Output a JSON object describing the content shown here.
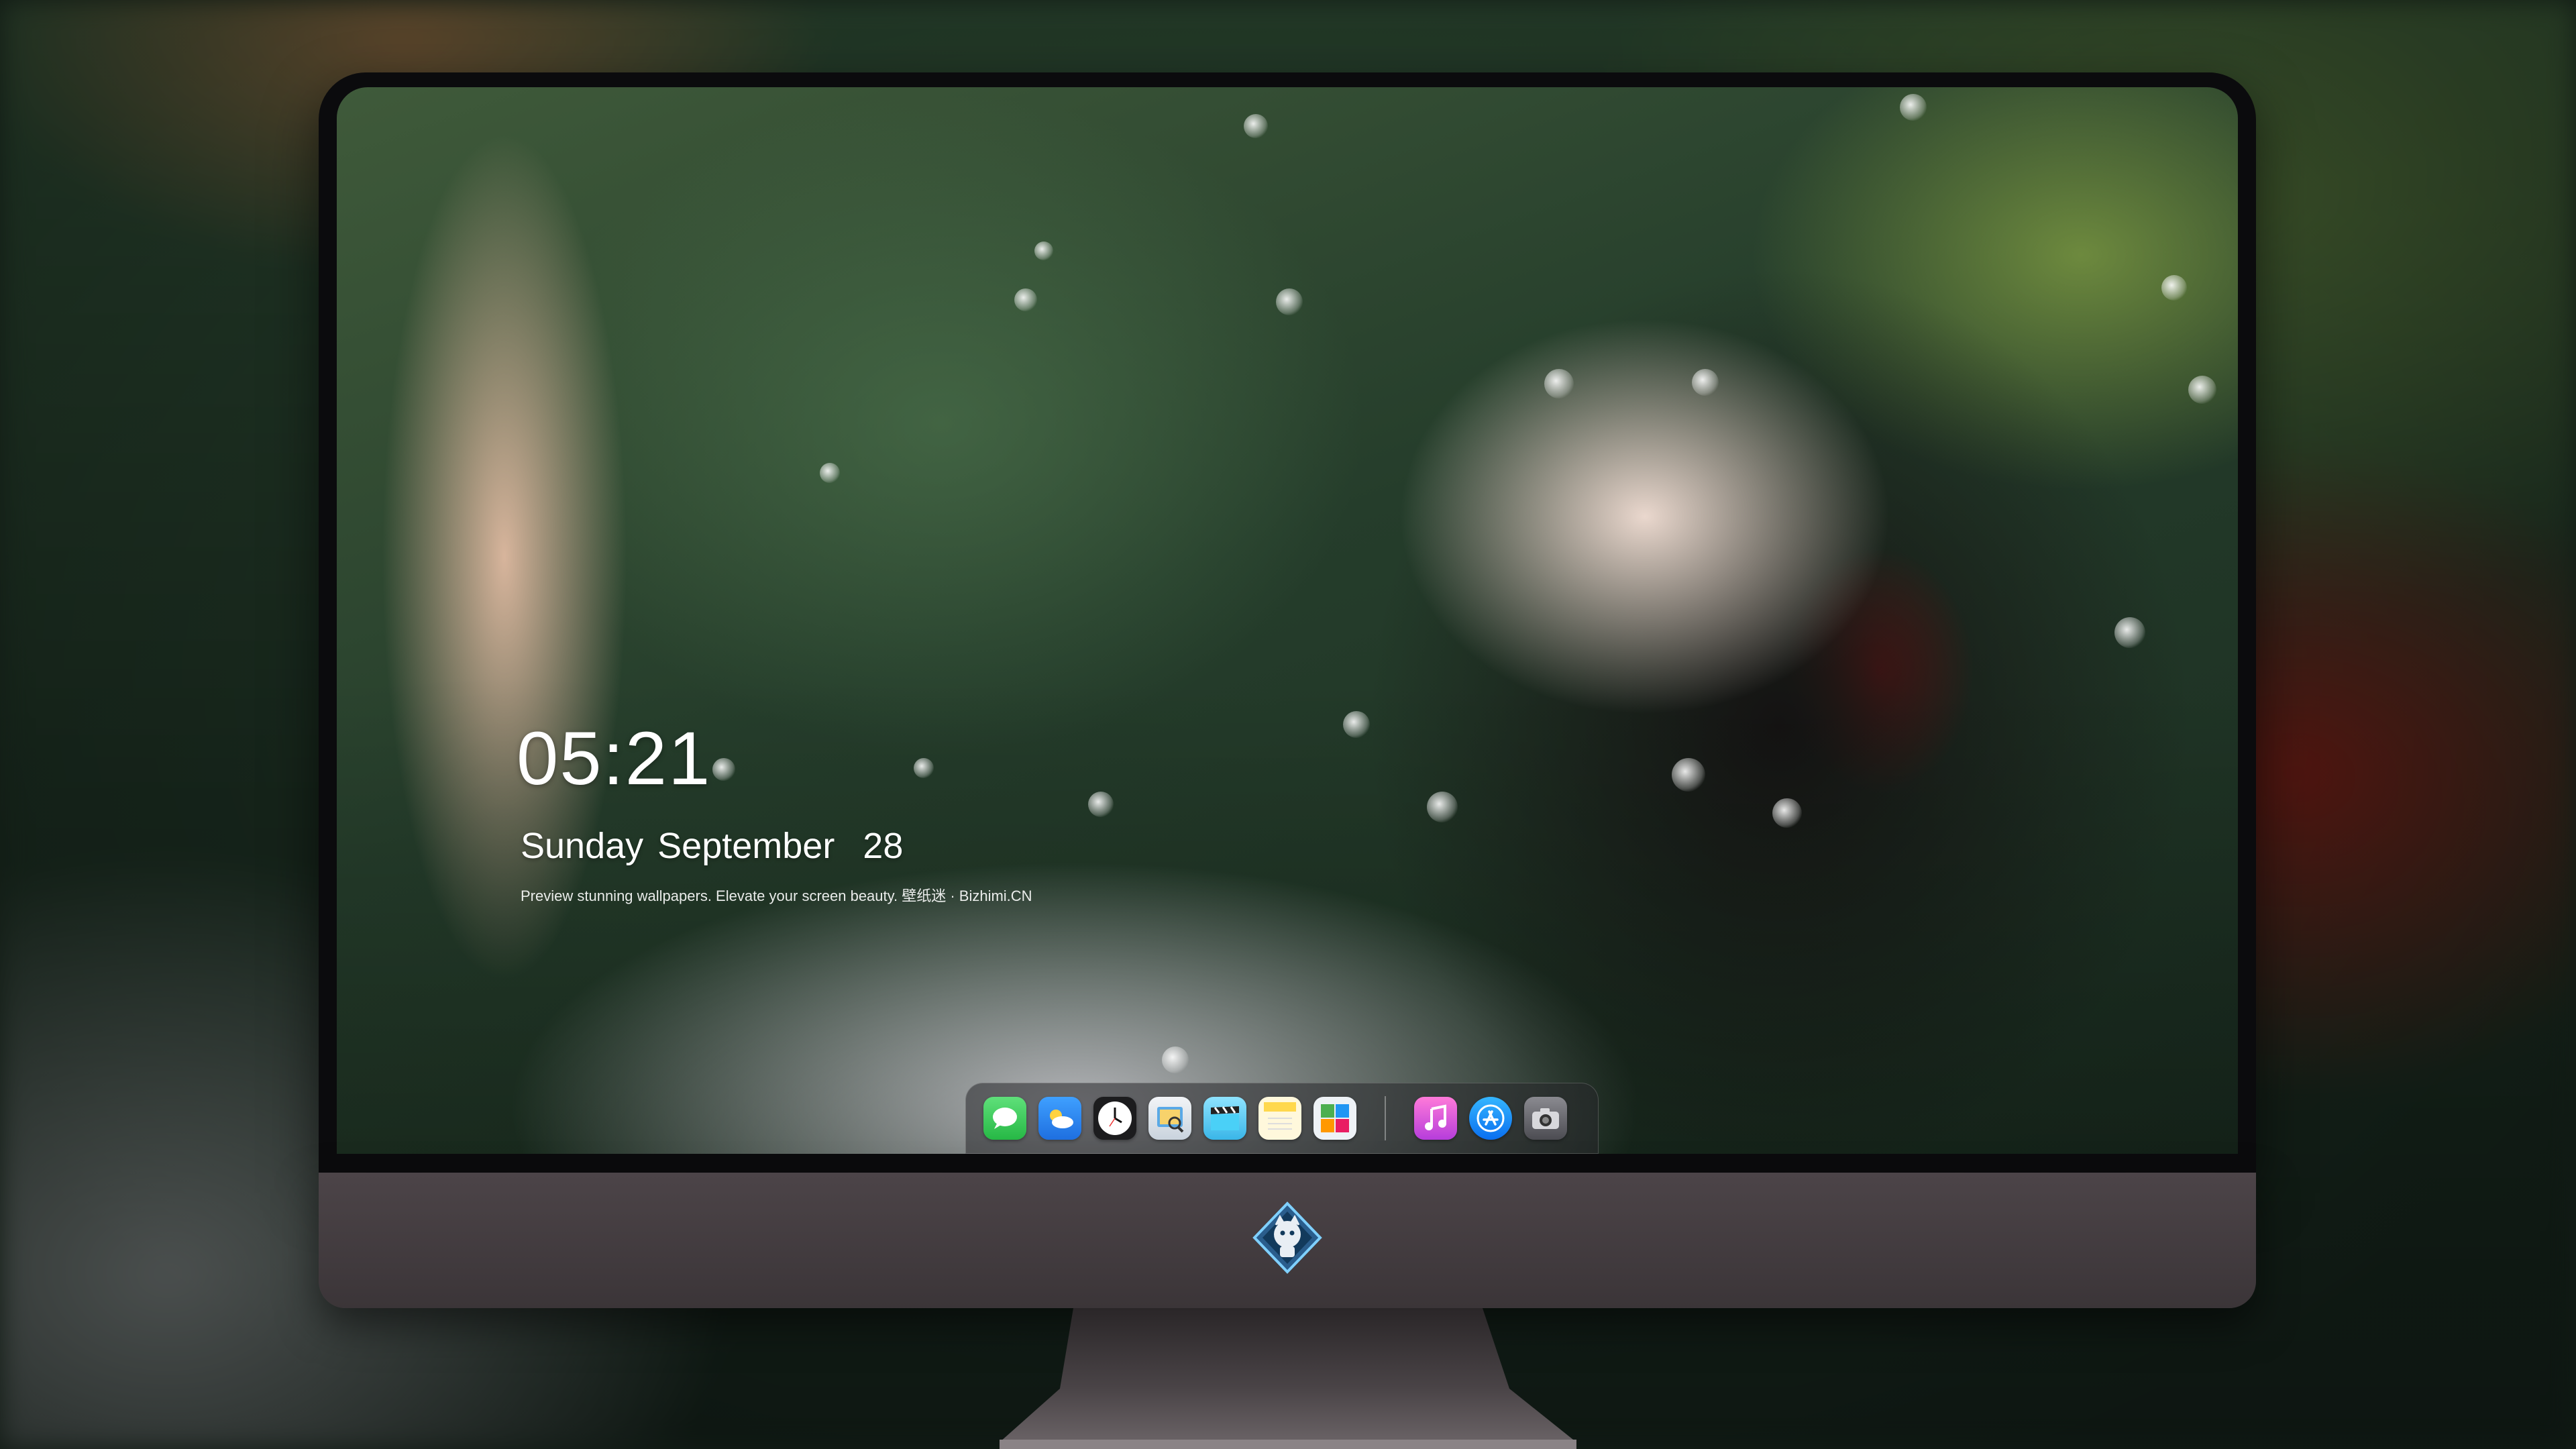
{
  "lock_screen": {
    "time": "05:21",
    "date": "Sunday September  28",
    "tagline": "Preview stunning wallpapers. Elevate your screen beauty. 壁纸迷 · Bizhimi.CN"
  },
  "dock": {
    "apps": [
      {
        "icon": "messages-icon",
        "color": "#34c759"
      },
      {
        "icon": "weather-icon",
        "color": "#2f8ff0"
      },
      {
        "icon": "clock-icon",
        "color": "#1c1c1e"
      },
      {
        "icon": "preview-icon",
        "color": "#dfe6ee"
      },
      {
        "icon": "claquette-icon",
        "color": "#5ac8fa"
      },
      {
        "icon": "notes-icon",
        "color": "#ffd84d"
      },
      {
        "icon": "photo-booth-icon",
        "color": "#e9eef4"
      },
      {
        "icon": "itunes-icon",
        "color": "#e651c6"
      },
      {
        "icon": "app-store-icon",
        "color": "#1a8cff"
      },
      {
        "icon": "camera-icon",
        "color": "#6b6b70"
      }
    ]
  },
  "monitor": {
    "logo": "mascot-logo-icon"
  }
}
